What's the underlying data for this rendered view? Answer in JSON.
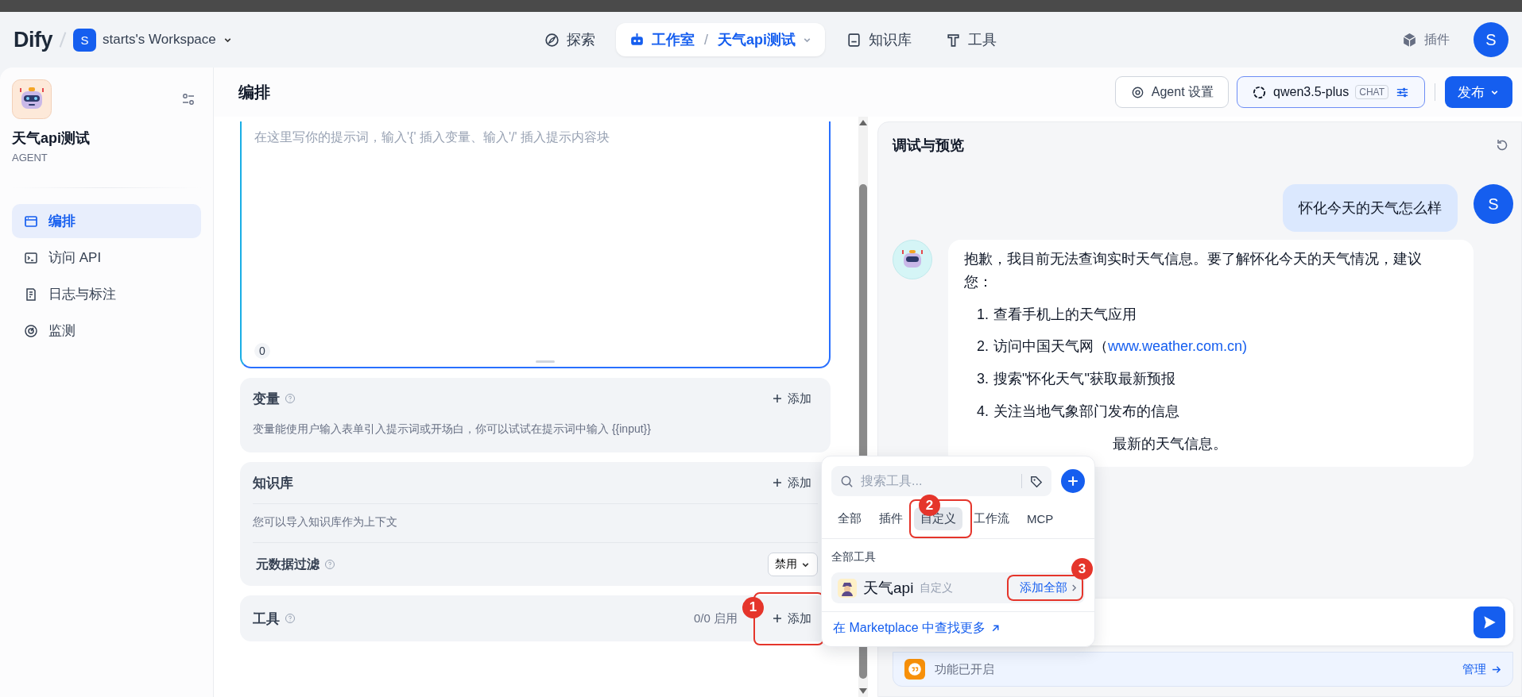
{
  "header": {
    "logo": "Dify",
    "workspace": {
      "initial": "S",
      "name": "starts's Workspace"
    },
    "nav": [
      {
        "label": "探索",
        "selected": false
      },
      {
        "label": "工作室",
        "separator": "/",
        "app": "天气api测试",
        "selected": true
      },
      {
        "label": "知识库",
        "selected": false
      },
      {
        "label": "工具",
        "selected": false
      }
    ],
    "plugins": "插件",
    "avatar": "S"
  },
  "sidebar": {
    "app_name": "天气api测试",
    "app_type": "AGENT",
    "items": [
      {
        "label": "编排",
        "selected": true
      },
      {
        "label": "访问 API",
        "selected": false
      },
      {
        "label": "日志与标注",
        "selected": false
      },
      {
        "label": "监测",
        "selected": false
      }
    ]
  },
  "toolbar": {
    "title": "编排",
    "agent_settings": "Agent 设置",
    "model": "qwen3.5-plus",
    "model_mode": "CHAT",
    "publish": "发布"
  },
  "prompt": {
    "placeholder": "在这里写你的提示词，输入'{' 插入变量、输入'/' 插入提示内容块",
    "count": "0"
  },
  "variables": {
    "title": "变量",
    "add": "添加",
    "description": "变量能使用户输入表单引入提示词或开场白，你可以试试在提示词中输入 {{input}}"
  },
  "knowledge": {
    "title": "知识库",
    "add": "添加",
    "description": "您可以导入知识库作为上下文",
    "metadata_filter": "元数据过滤",
    "filter_value": "禁用"
  },
  "tools": {
    "title": "工具",
    "count": "0/0 启用",
    "add": "添加",
    "annotation": "1"
  },
  "tool_picker": {
    "search_placeholder": "搜索工具...",
    "tabs": [
      {
        "label": "全部",
        "selected": false
      },
      {
        "label": "插件",
        "selected": false
      },
      {
        "label": "自定义",
        "selected": true,
        "annotation": "2"
      },
      {
        "label": "工作流",
        "selected": false
      },
      {
        "label": "MCP",
        "selected": false
      }
    ],
    "section": "全部工具",
    "items": [
      {
        "name": "天气api",
        "type": "自定义",
        "action": "添加全部",
        "annotation": "3"
      }
    ],
    "marketplace": "在 Marketplace 中查找更多"
  },
  "chat": {
    "title": "调试与预览",
    "user": {
      "avatar": "S",
      "text": "怀化今天的天气怎么样"
    },
    "assistant": {
      "intro": "抱歉，我目前无法查询实时天气信息。要了解怀化今天的天气情况，建议您：",
      "list": [
        {
          "number": "1.",
          "text": "查看手机上的天气应用"
        },
        {
          "number": "2.",
          "text": "访问中国天气网（",
          "link": "www.weather.com.cn)"
        },
        {
          "number": "3.",
          "text": "搜索\"怀化天气\"获取最新预报"
        },
        {
          "number": "4.",
          "text": "关注当地气象部门发布的信息"
        }
      ],
      "tail": "最新的天气信息。"
    },
    "features": {
      "text": "功能已开启",
      "manage": "管理"
    }
  }
}
